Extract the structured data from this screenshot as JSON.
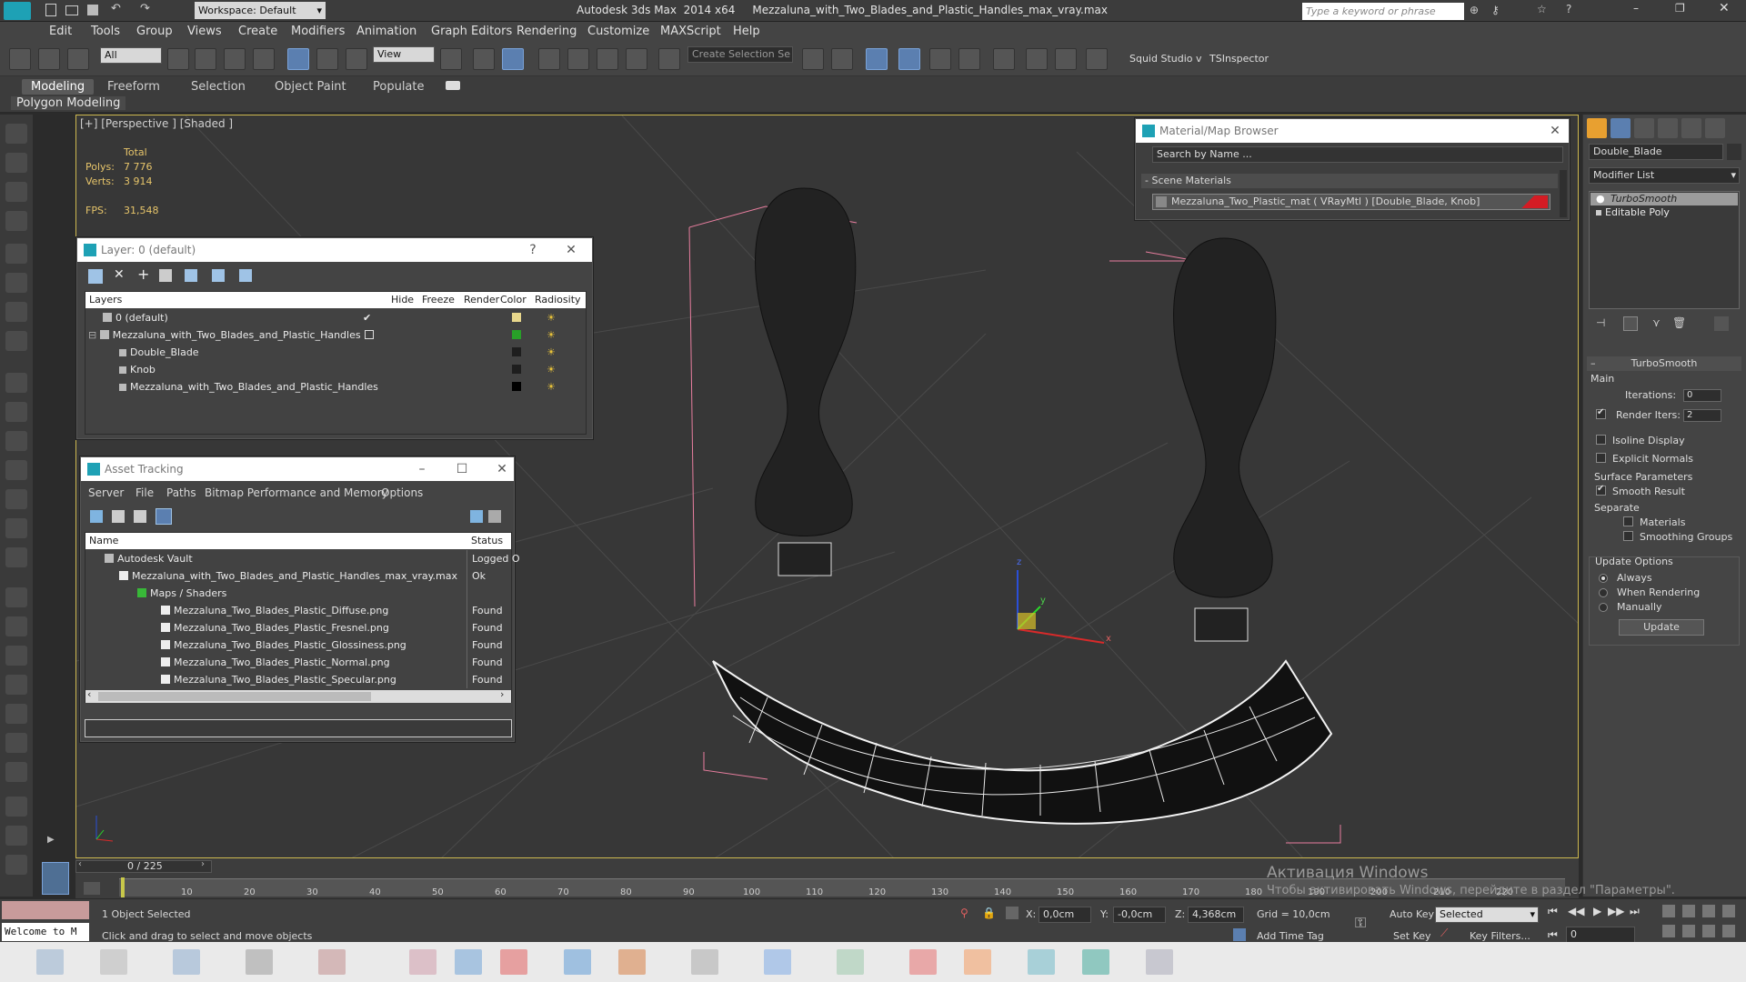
{
  "app_title": "Autodesk 3ds Max  2014 x64     Mezzaluna_with_Two_Blades_and_Plastic_Handles_max_vray.max",
  "workspace": "Workspace: Default",
  "search_placeholder": "Type a keyword or phrase",
  "menu": [
    "Edit",
    "Tools",
    "Group",
    "Views",
    "Create",
    "Modifiers",
    "Animation",
    "Graph Editors",
    "Rendering",
    "Customize",
    "MAXScript",
    "Help"
  ],
  "toolbar": {
    "filter": "All",
    "view": "View",
    "selection_set": "Create Selection Se",
    "squid": "Squid Studio v",
    "tsinspector": "TSInspector"
  },
  "ribbon": {
    "tabs": [
      "Modeling",
      "Freeform",
      "Selection",
      "Object Paint",
      "Populate"
    ],
    "sub": "Polygon Modeling"
  },
  "viewport": {
    "label": "[+] [Perspective ] [Shaded ]",
    "total": "Total",
    "polys_label": "Polys:",
    "polys": "7 776",
    "verts_label": "Verts:",
    "verts": "3 914",
    "fps_label": "FPS:",
    "fps": "31,548"
  },
  "layer_window": {
    "title": "Layer: 0 (default)",
    "help": "?",
    "headers": [
      "Layers",
      "Hide",
      "Freeze",
      "Render",
      "Color",
      "Radiosity"
    ],
    "rows": [
      {
        "name": "0 (default)",
        "color": "#e8d78c"
      },
      {
        "name": "Mezzaluna_with_Two_Blades_and_Plastic_Handles",
        "color": "#28a028"
      },
      {
        "name": "Double_Blade",
        "color": "#1e1e1e"
      },
      {
        "name": "Knob",
        "color": "#1e1e1e"
      },
      {
        "name": "Mezzaluna_with_Two_Blades_and_Plastic_Handles",
        "color": "#000000"
      }
    ]
  },
  "asset_window": {
    "title": "Asset Tracking",
    "menu": [
      "Server",
      "File",
      "Paths",
      "Bitmap Performance and Memory",
      "Options"
    ],
    "headers": [
      "Name",
      "Status"
    ],
    "rows": [
      {
        "name": "Autodesk Vault",
        "status": "Logged O"
      },
      {
        "name": "Mezzaluna_with_Two_Blades_and_Plastic_Handles_max_vray.max",
        "status": "Ok"
      },
      {
        "name": "Maps / Shaders",
        "status": ""
      },
      {
        "name": "Mezzaluna_Two_Blades_Plastic_Diffuse.png",
        "status": "Found"
      },
      {
        "name": "Mezzaluna_Two_Blades_Plastic_Fresnel.png",
        "status": "Found"
      },
      {
        "name": "Mezzaluna_Two_Blades_Plastic_Glossiness.png",
        "status": "Found"
      },
      {
        "name": "Mezzaluna_Two_Blades_Plastic_Normal.png",
        "status": "Found"
      },
      {
        "name": "Mezzaluna_Two_Blades_Plastic_Specular.png",
        "status": "Found"
      }
    ]
  },
  "material_browser": {
    "title": "Material/Map Browser",
    "search": "Search by Name ...",
    "section": "- Scene Materials",
    "item": "Mezzaluna_Two_Plastic_mat  ( VRayMtl ) [Double_Blade, Knob]"
  },
  "right_panel": {
    "object_name": "Double_Blade",
    "modifier_list": "Modifier List",
    "stack": [
      "TurboSmooth",
      "Editable Poly"
    ],
    "turbosmooth": {
      "title": "TurboSmooth",
      "main": "Main",
      "iterations_label": "Iterations:",
      "iterations": "0",
      "render_iters_label": "Render Iters:",
      "render_iters": "2",
      "isoline": "Isoline Display",
      "explicit": "Explicit Normals",
      "surface": "Surface Parameters",
      "smooth": "Smooth Result",
      "separate": "Separate",
      "materials": "Materials",
      "smoothing": "Smoothing Groups",
      "update_options": "Update Options",
      "always": "Always",
      "when_rendering": "When Rendering",
      "manually": "Manually",
      "update": "Update"
    }
  },
  "timeline": {
    "frame": "0 / 225",
    "ticks": [
      "10",
      "20",
      "30",
      "40",
      "50",
      "60",
      "70",
      "80",
      "90",
      "100",
      "110",
      "120",
      "130",
      "140",
      "150",
      "160",
      "170",
      "180",
      "190",
      "200",
      "210",
      "220"
    ]
  },
  "status": {
    "welcome": "Welcome to M",
    "selected": "1 Object Selected",
    "prompt": "Click and drag to select and move objects",
    "x_label": "X:",
    "x": "0,0cm",
    "y_label": "Y:",
    "y": "-0,0cm",
    "z_label": "Z:",
    "z": "4,368cm",
    "grid": "Grid = 10,0cm",
    "add_time_tag": "Add Time Tag",
    "auto_key": "Auto Key",
    "set_key": "Set Key",
    "key_mode": "Selected",
    "key_filters": "Key Filters...",
    "frame_field": "0"
  },
  "activation": {
    "line1": "Активация Windows",
    "line2": "Чтобы активировать Windows, перейдите в раздел \"Параметры\"."
  },
  "axis_labels": {
    "x": "x",
    "y": "y",
    "z": "z"
  }
}
